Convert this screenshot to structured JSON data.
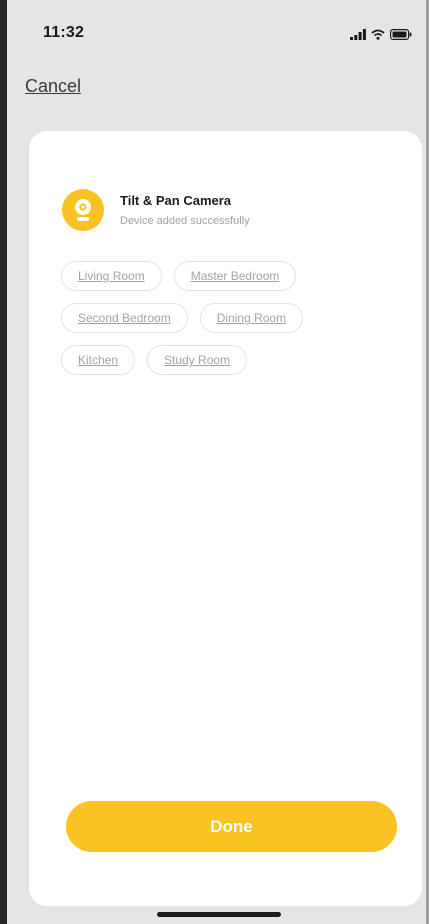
{
  "status_bar": {
    "time": "11:32",
    "icons": [
      "signal-icon",
      "wifi-icon",
      "battery-icon"
    ]
  },
  "header": {
    "cancel_label": "Cancel"
  },
  "device": {
    "icon": "camera-icon",
    "name": "Tilt & Pan Camera",
    "status": "Device added successfully"
  },
  "rooms": [
    [
      "Living Room",
      "Master Bedroom"
    ],
    [
      "Second Bedroom",
      "Dining Room"
    ],
    [
      "Kitchen",
      "Study Room"
    ]
  ],
  "footer": {
    "done_label": "Done"
  },
  "colors": {
    "accent": "#fbc223",
    "background": "#e5e5e5",
    "card": "#ffffff",
    "chip_text": "#a3a3a3"
  }
}
